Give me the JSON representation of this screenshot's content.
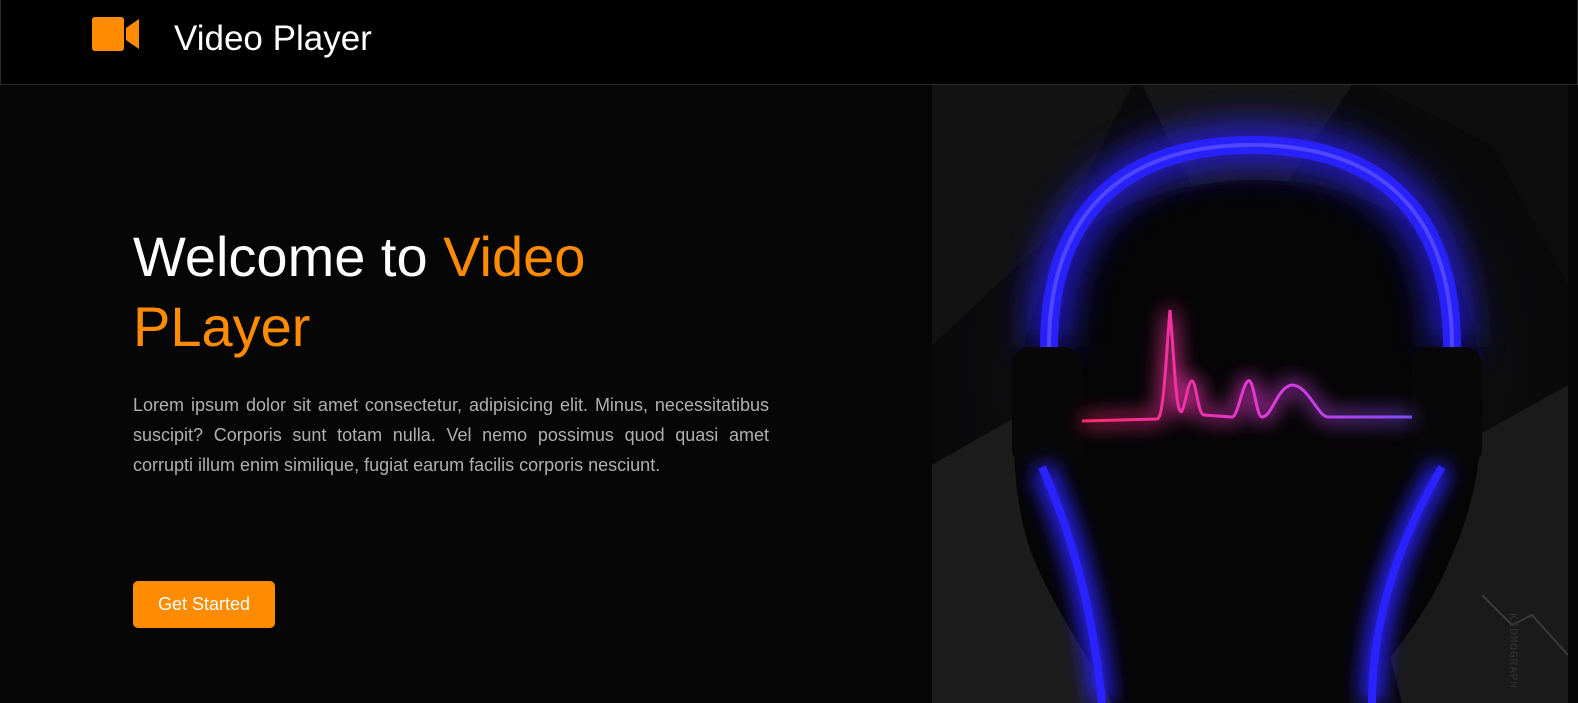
{
  "navbar": {
    "logo_icon": "video-camera-icon",
    "title": "Video Player"
  },
  "hero": {
    "heading_plain": "Welcome to ",
    "heading_accent": "Video PLayer",
    "description": "Lorem ipsum dolor sit amet consectetur, adipisicing elit. Minus, necessitatibus suscipit? Corporis sunt totam nulla. Vel nemo possimus quod quasi amet corrupti illum enim similique, fugiat earum facilis corporis nesciunt.",
    "cta_label": "Get Started",
    "image": {
      "description_icon": "headphones-soundwave-illustration",
      "watermark": "KIDMOGRAPH"
    }
  },
  "colors": {
    "accent": "#ff8c00",
    "background": "#060606",
    "navbar": "#000000",
    "text_primary": "#ffffff",
    "text_muted": "#b0b0b0",
    "headphone_glow": "#2a22ff",
    "wave_start": "#ff2a6a",
    "wave_end": "#7b4dff"
  }
}
